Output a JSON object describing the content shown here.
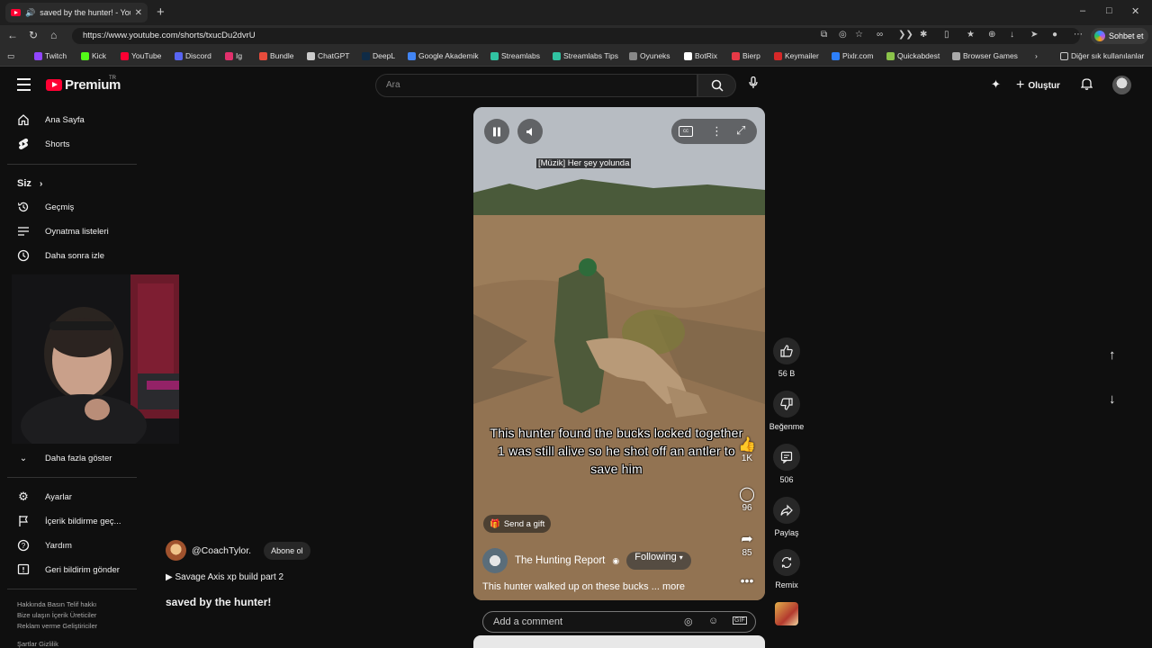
{
  "browser": {
    "tab_title": "saved by the hunter! - YouTub",
    "tab_close": "✕",
    "new_tab": "+",
    "url": "https://www.youtube.com/shorts/txucDu2dvrU",
    "sohbet": "Sohbet et",
    "window_controls": [
      "–",
      "□",
      "✕"
    ]
  },
  "bookmarks": [
    {
      "label": "Twitch",
      "color": "#9146ff"
    },
    {
      "label": "Kick",
      "color": "#53fc18"
    },
    {
      "label": "YouTube",
      "color": "#ff0033"
    },
    {
      "label": "Discord",
      "color": "#5865f2"
    },
    {
      "label": "Ig",
      "color": "#e1306c"
    },
    {
      "label": "Bundle",
      "color": "#e74c3c"
    },
    {
      "label": "ChatGPT",
      "color": "#cccccc"
    },
    {
      "label": "DeepL",
      "color": "#0f2b46"
    },
    {
      "label": "Google Akademik",
      "color": "#4285f4"
    },
    {
      "label": "Streamlabs",
      "color": "#31c3a2"
    },
    {
      "label": "Streamlabs Tips",
      "color": "#31c3a2"
    },
    {
      "label": "Oyuneks",
      "color": "#888888"
    },
    {
      "label": "BotRix",
      "color": "#ffffff"
    },
    {
      "label": "Bierp",
      "color": "#e63946"
    },
    {
      "label": "Keymailer",
      "color": "#d62828"
    },
    {
      "label": "Pixlr.com",
      "color": "#2d7ff9"
    },
    {
      "label": "Quickabdest",
      "color": "#8bc34a"
    },
    {
      "label": "Browser Games",
      "color": "#aaaaaa"
    }
  ],
  "bookmarks_other": "Diğer sık kullanılanlar",
  "header": {
    "logo_text": "Premium",
    "logo_region": "TR",
    "search_placeholder": "Ara",
    "create_label": "Oluştur"
  },
  "sidebar": {
    "top_items": [
      {
        "label": "Ana Sayfa",
        "icon": "home-icon"
      },
      {
        "label": "Shorts",
        "icon": "shorts-icon"
      }
    ],
    "you_heading": "Siz",
    "you_items": [
      {
        "label": "Geçmiş",
        "icon": "history-icon"
      },
      {
        "label": "Oynatma listeleri",
        "icon": "playlist-icon"
      },
      {
        "label": "Daha sonra izle",
        "icon": "watch-later-icon"
      }
    ],
    "show_more": "Daha fazla göster",
    "bottom_items": [
      {
        "label": "Ayarlar",
        "icon": "settings-icon"
      },
      {
        "label": "İçerik bildirme geç...",
        "icon": "flag-icon"
      },
      {
        "label": "Yardım",
        "icon": "help-icon"
      },
      {
        "label": "Geri bildirim gönder",
        "icon": "feedback-icon"
      }
    ],
    "footer_line1": "Hakkında  Basın  Telif hakkı",
    "footer_line2": "Bize ulaşın  İçerik Üreticiler",
    "footer_line3": "Reklam verme  Geliştiriciler",
    "footer_line4": "Şartlar  Gizlilik"
  },
  "short": {
    "caption_top": "[Müzik] Her şey yolunda",
    "overlay_text": "This hunter found the bucks locked together 1 was still alive so he shot off an antler to save him",
    "send_gift": "Send a gift",
    "channel_name": "The Hunting Report",
    "following": "Following",
    "description": "This hunter walked up on these bucks ...",
    "more": "more",
    "inner_counts": {
      "like": "1K",
      "comment": "96",
      "share": "85"
    },
    "add_comment": "Add a comment"
  },
  "actions": {
    "likes": "56 B",
    "dislike": "Beğenme",
    "comments": "506",
    "share": "Paylaş",
    "remix": "Remix"
  },
  "video_info": {
    "username": "@CoachTylor.",
    "subscribe": "Abone ol",
    "playlist": "▶  Savage Axis xp build part 2",
    "title": "saved by the hunter!"
  }
}
